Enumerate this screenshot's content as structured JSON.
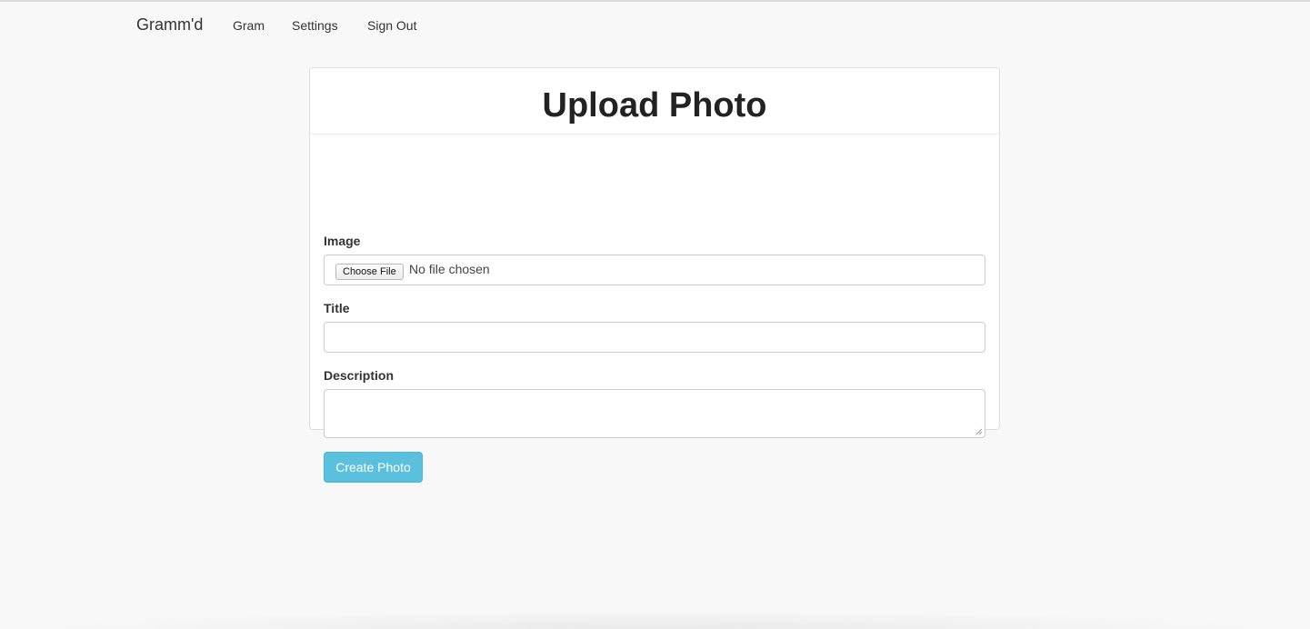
{
  "nav": {
    "brand": "Gramm'd",
    "links": [
      {
        "label": "Gram"
      },
      {
        "label": "Settings"
      },
      {
        "label": "Sign Out"
      }
    ]
  },
  "form": {
    "title": "Upload Photo",
    "image": {
      "label": "Image",
      "button_label": "Choose File",
      "status": "No file chosen"
    },
    "title_field": {
      "label": "Title",
      "value": ""
    },
    "description_field": {
      "label": "Description",
      "value": ""
    },
    "submit_label": "Create Photo"
  },
  "colors": {
    "background": "#f8f8f8",
    "accent_button": "#5bc0de"
  }
}
